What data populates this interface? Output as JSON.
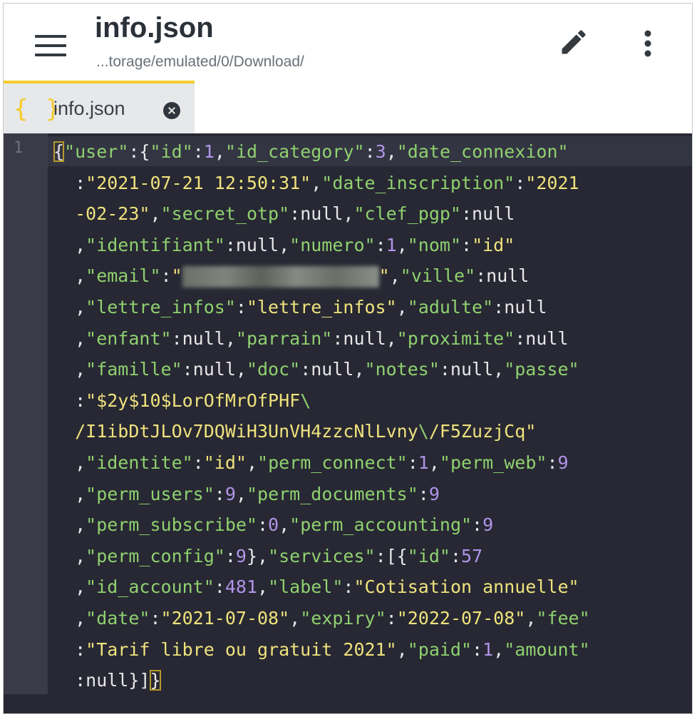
{
  "app": {
    "title": "info.json",
    "path": "...torage/emulated/0/Download/",
    "icons": {
      "menu": "hamburger-menu-icon",
      "edit": "pencil-icon",
      "more": "more-vert-icon"
    }
  },
  "tab": {
    "icon": "{ }",
    "label": "info.json",
    "close_icon": "close-circle-icon",
    "accent": "#f4cc2c"
  },
  "editor": {
    "line_number": "1",
    "colors": {
      "background": "#272833",
      "gutter": "#3a3b47",
      "key": "#8fd16f",
      "string": "#efe27d",
      "number": "#b194e8",
      "punctuation": "#e8e8ea"
    },
    "lines": [
      [
        [
          "p",
          "{"
        ],
        [
          "k",
          "\"user\""
        ],
        [
          "p",
          ":{"
        ],
        [
          "k",
          "\"id\""
        ],
        [
          "p",
          ":"
        ],
        [
          "n",
          "1"
        ],
        [
          "p",
          ","
        ],
        [
          "k",
          "\"id_category\""
        ],
        [
          "p",
          ":"
        ],
        [
          "n",
          "3"
        ],
        [
          "p",
          ","
        ],
        [
          "k",
          "\"date_connexion\""
        ]
      ],
      [
        [
          "p",
          "  :"
        ],
        [
          "s",
          "\"2021-07-21 12:50:31\""
        ],
        [
          "p",
          ","
        ],
        [
          "k",
          "\"date_inscription\""
        ],
        [
          "p",
          ":"
        ],
        [
          "s",
          "\"2021"
        ]
      ],
      [
        [
          "s",
          "  -02-23\""
        ],
        [
          "p",
          ","
        ],
        [
          "k",
          "\"secret_otp\""
        ],
        [
          "p",
          ":null,"
        ],
        [
          "k",
          "\"clef_pgp\""
        ],
        [
          "p",
          ":null"
        ]
      ],
      [
        [
          "p",
          "  ,"
        ],
        [
          "k",
          "\"identifiant\""
        ],
        [
          "p",
          ":null,"
        ],
        [
          "k",
          "\"numero\""
        ],
        [
          "p",
          ":"
        ],
        [
          "n",
          "1"
        ],
        [
          "p",
          ","
        ],
        [
          "k",
          "\"nom\""
        ],
        [
          "p",
          ":"
        ],
        [
          "s",
          "\"id\""
        ]
      ],
      [
        [
          "p",
          "  ,"
        ],
        [
          "k",
          "\"email\""
        ],
        [
          "p",
          ":"
        ],
        [
          "s",
          "\""
        ],
        [
          "blur",
          ""
        ],
        [
          "s",
          "\""
        ],
        [
          "p",
          ","
        ],
        [
          "k",
          "\"ville\""
        ],
        [
          "p",
          ":null"
        ]
      ],
      [
        [
          "p",
          "  ,"
        ],
        [
          "k",
          "\"lettre_infos\""
        ],
        [
          "p",
          ":"
        ],
        [
          "s",
          "\"lettre_infos\""
        ],
        [
          "p",
          ","
        ],
        [
          "k",
          "\"adulte\""
        ],
        [
          "p",
          ":null"
        ]
      ],
      [
        [
          "p",
          "  ,"
        ],
        [
          "k",
          "\"enfant\""
        ],
        [
          "p",
          ":null,"
        ],
        [
          "k",
          "\"parrain\""
        ],
        [
          "p",
          ":null,"
        ],
        [
          "k",
          "\"proximite\""
        ],
        [
          "p",
          ":null"
        ]
      ],
      [
        [
          "p",
          "  ,"
        ],
        [
          "k",
          "\"famille\""
        ],
        [
          "p",
          ":null,"
        ],
        [
          "k",
          "\"doc\""
        ],
        [
          "p",
          ":null,"
        ],
        [
          "k",
          "\"notes\""
        ],
        [
          "p",
          ":null,"
        ],
        [
          "k",
          "\"passe\""
        ]
      ],
      [
        [
          "p",
          "  :"
        ],
        [
          "s",
          "\"$2y$10$LorOfMrOfPHF"
        ],
        [
          "e",
          "\\"
        ]
      ],
      [
        [
          "s",
          "  /I1ibDtJLOv7DQWiH3UnVH4zzcNlLvny"
        ],
        [
          "e",
          "\\"
        ],
        [
          "s",
          "/F5ZuzjCq\""
        ]
      ],
      [
        [
          "p",
          "  ,"
        ],
        [
          "k",
          "\"identite\""
        ],
        [
          "p",
          ":"
        ],
        [
          "s",
          "\"id\""
        ],
        [
          "p",
          ","
        ],
        [
          "k",
          "\"perm_connect\""
        ],
        [
          "p",
          ":"
        ],
        [
          "n",
          "1"
        ],
        [
          "p",
          ","
        ],
        [
          "k",
          "\"perm_web\""
        ],
        [
          "p",
          ":"
        ],
        [
          "n",
          "9"
        ]
      ],
      [
        [
          "p",
          "  ,"
        ],
        [
          "k",
          "\"perm_users\""
        ],
        [
          "p",
          ":"
        ],
        [
          "n",
          "9"
        ],
        [
          "p",
          ","
        ],
        [
          "k",
          "\"perm_documents\""
        ],
        [
          "p",
          ":"
        ],
        [
          "n",
          "9"
        ]
      ],
      [
        [
          "p",
          "  ,"
        ],
        [
          "k",
          "\"perm_subscribe\""
        ],
        [
          "p",
          ":"
        ],
        [
          "n",
          "0"
        ],
        [
          "p",
          ","
        ],
        [
          "k",
          "\"perm_accounting\""
        ],
        [
          "p",
          ":"
        ],
        [
          "n",
          "9"
        ]
      ],
      [
        [
          "p",
          "  ,"
        ],
        [
          "k",
          "\"perm_config\""
        ],
        [
          "p",
          ":"
        ],
        [
          "n",
          "9"
        ],
        [
          "p",
          "},"
        ],
        [
          "k",
          "\"services\""
        ],
        [
          "p",
          ":[{"
        ],
        [
          "k",
          "\"id\""
        ],
        [
          "p",
          ":"
        ],
        [
          "n",
          "57"
        ]
      ],
      [
        [
          "p",
          "  ,"
        ],
        [
          "k",
          "\"id_account\""
        ],
        [
          "p",
          ":"
        ],
        [
          "n",
          "481"
        ],
        [
          "p",
          ","
        ],
        [
          "k",
          "\"label\""
        ],
        [
          "p",
          ":"
        ],
        [
          "s",
          "\"Cotisation annuelle\""
        ]
      ],
      [
        [
          "p",
          "  ,"
        ],
        [
          "k",
          "\"date\""
        ],
        [
          "p",
          ":"
        ],
        [
          "s",
          "\"2021-07-08\""
        ],
        [
          "p",
          ","
        ],
        [
          "k",
          "\"expiry\""
        ],
        [
          "p",
          ":"
        ],
        [
          "s",
          "\"2022-07-08\""
        ],
        [
          "p",
          ","
        ],
        [
          "k",
          "\"fee\""
        ]
      ],
      [
        [
          "p",
          "  :"
        ],
        [
          "s",
          "\"Tarif libre ou gratuit 2021\""
        ],
        [
          "p",
          ","
        ],
        [
          "k",
          "\"paid\""
        ],
        [
          "p",
          ":"
        ],
        [
          "n",
          "1"
        ],
        [
          "p",
          ","
        ],
        [
          "k",
          "\"amount\""
        ]
      ],
      [
        [
          "p",
          "  :null}]"
        ],
        [
          "p",
          "}"
        ]
      ]
    ]
  }
}
